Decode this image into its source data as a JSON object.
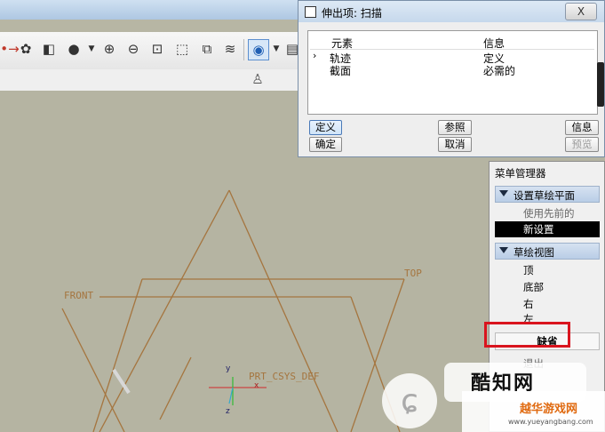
{
  "dialog": {
    "title": "伸出项: 扫描",
    "close": "X",
    "columns": [
      "元素",
      "信息"
    ],
    "rows": [
      {
        "element": "轨迹",
        "info": "定义",
        "current": true
      },
      {
        "element": "截面",
        "info": "必需的",
        "current": false
      }
    ],
    "buttons": {
      "define": "定义",
      "reference": "参照",
      "info": "信息",
      "ok": "确定",
      "cancel": "取消",
      "preview": "预览"
    }
  },
  "menu_manager": {
    "title": "菜单管理器",
    "section_plane": "设置草绘平面",
    "use_previous": "使用先前的",
    "new_setting": "新设置",
    "section_view": "草绘视图",
    "top": "顶",
    "bottom": "底部",
    "right": "右",
    "left": "左",
    "default": "缺省",
    "exit": "退出"
  },
  "canvas": {
    "front_label": "FRONT",
    "top_label": "TOP",
    "csys_label": "PRT_CSYS_DEF",
    "axis_x": "x",
    "axis_y": "y",
    "axis_z": "z"
  },
  "watermark": {
    "brand1": "酷知网",
    "brand2": "越华游戏网",
    "url": "www.yueyangbang.com"
  },
  "colors": {
    "datum": "#a5753f",
    "highlight": "#d9141e",
    "selected_bg": "#000000",
    "section_bg": "#c6d6ea"
  }
}
